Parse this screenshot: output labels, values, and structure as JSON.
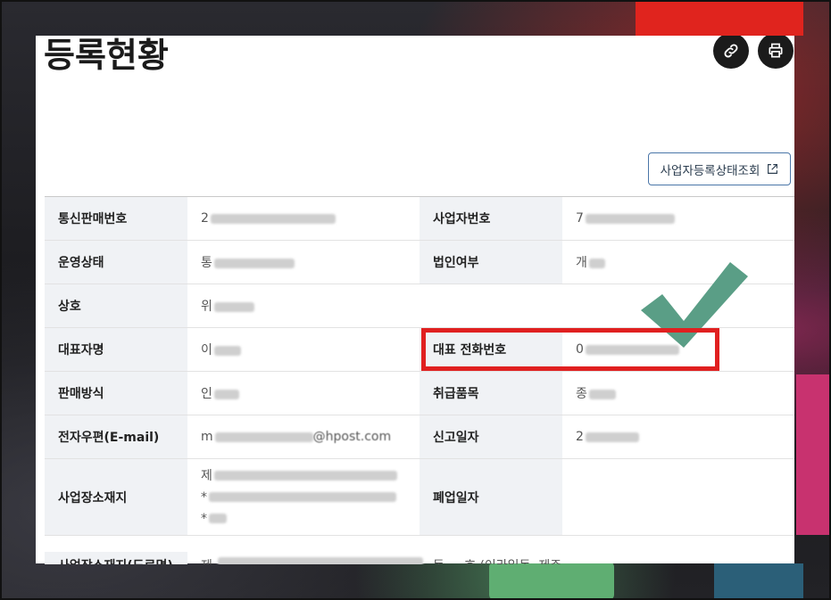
{
  "page": {
    "title": "등록현황"
  },
  "header_actions": {
    "link_icon": "link-icon",
    "print_icon": "printer-icon"
  },
  "status_button": {
    "label": "사업자등록상태조회",
    "icon": "external-link-icon"
  },
  "table": {
    "rows": [
      {
        "l1": "통신판매번호",
        "v1": "2",
        "l2": "사업자번호",
        "v2": "7"
      },
      {
        "l1": "운영상태",
        "v1": "통",
        "l2": "법인여부",
        "v2": "개"
      },
      {
        "l1": "상호",
        "v1": "위",
        "l2": "",
        "v2": ""
      },
      {
        "l1": "대표자명",
        "v1": "이",
        "l2": "대표 전화번호",
        "v2": "0"
      },
      {
        "l1": "판매방식",
        "v1": "인",
        "l2": "취급품목",
        "v2": "종"
      },
      {
        "l1": "전자우편(E-mail)",
        "v1": "m",
        "v1_suffix": "@hpost.com",
        "l2": "신고일자",
        "v2": "2"
      },
      {
        "l1": "사업장소재지",
        "v1_lines": [
          "제",
          "*",
          "*"
        ],
        "l2": "폐업일자",
        "v2": ""
      },
      {
        "l1": "사업장소재지(도로명)",
        "v1": "제",
        "l2": "",
        "v2": "동 ... 호 (이라일동, 제주"
      }
    ]
  },
  "colors": {
    "highlight": "#e02020",
    "checkmark": "#5a9e86",
    "accent_border": "#4a76a8"
  }
}
